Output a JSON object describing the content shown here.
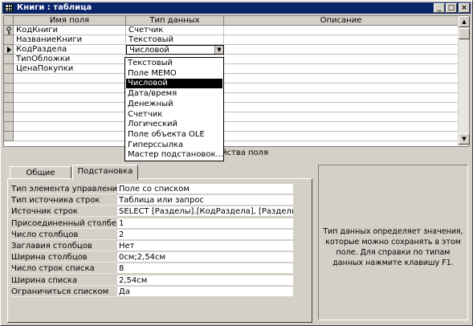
{
  "window": {
    "title": "Книги : таблица",
    "controls": {
      "minimize": "_",
      "maximize": "□",
      "close": "×"
    }
  },
  "grid": {
    "headers": {
      "field": "Имя поля",
      "type": "Тип данных",
      "desc": "Описание"
    },
    "rows": [
      {
        "name": "КодКниги",
        "type": "Счетчик",
        "marker": "key-icon"
      },
      {
        "name": "НазваниеКниги",
        "type": "Текстовый",
        "marker": ""
      },
      {
        "name": "КодРаздела",
        "type": "Числовой",
        "marker": "current-row-arrow-icon"
      },
      {
        "name": "ТипОбложки",
        "type": "",
        "marker": ""
      },
      {
        "name": "ЦенаПокупки",
        "type": "",
        "marker": ""
      }
    ],
    "type_dropdown": {
      "selected": "Числовой",
      "options": [
        "Текстовый",
        "Поле MEMO",
        "Числовой",
        "Дата/время",
        "Денежный",
        "Счетчик",
        "Логический",
        "Поле объекта OLE",
        "Гиперссылка",
        "Мастер подстановок..."
      ]
    }
  },
  "properties": {
    "section_label": "йства поля",
    "tabs": [
      {
        "label": "Общие",
        "active": false
      },
      {
        "label": "Подстановка",
        "active": true
      }
    ],
    "rows": [
      {
        "label": "Тип элемента управления",
        "value": "Поле со списком"
      },
      {
        "label": "Тип источника строк",
        "value": "Таблица или запрос"
      },
      {
        "label": "Источник строк",
        "value": "SELECT [Разделы].[КодРаздела], [Разделы"
      },
      {
        "label": "Присоединенный столбец",
        "value": "1"
      },
      {
        "label": "Число столбцов",
        "value": "2"
      },
      {
        "label": "Заглавия столбцов",
        "value": "Нет"
      },
      {
        "label": "Ширина столбцов",
        "value": "0см;2,54см"
      },
      {
        "label": "Число строк списка",
        "value": "8"
      },
      {
        "label": "Ширина списка",
        "value": "2,54см"
      },
      {
        "label": "Ограничиться списком",
        "value": "Да"
      }
    ],
    "help_text": "Тип данных определяет значения, которые можно сохранять в этом поле.  Для справки по типам данных нажмите клавишу F1."
  },
  "colors": {
    "titlebar": "#0a246a",
    "face": "#d4d0c8",
    "selection": "#000000"
  }
}
